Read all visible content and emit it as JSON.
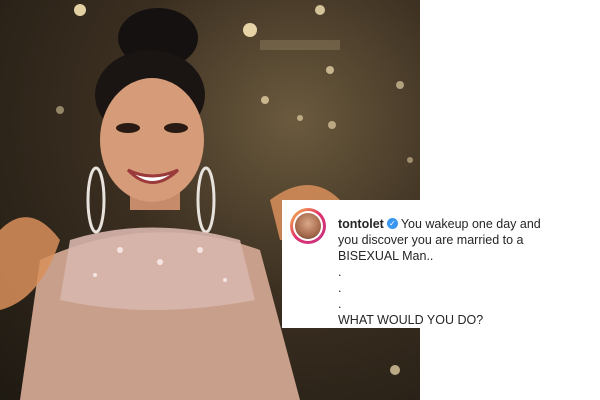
{
  "post": {
    "username": "tontolet",
    "caption_line1": "You wakeup one day and",
    "caption_line2": "you discover you are married to a",
    "caption_line3": "BISEXUAL Man..",
    "dot1": ".",
    "dot2": ".",
    "dot3": ".",
    "question": "WHAT WOULD YOU DO?"
  },
  "icons": {
    "verified": "verified-badge-icon",
    "avatar": "profile-avatar"
  },
  "colors": {
    "verified_blue": "#3897f0",
    "text": "#262626"
  }
}
